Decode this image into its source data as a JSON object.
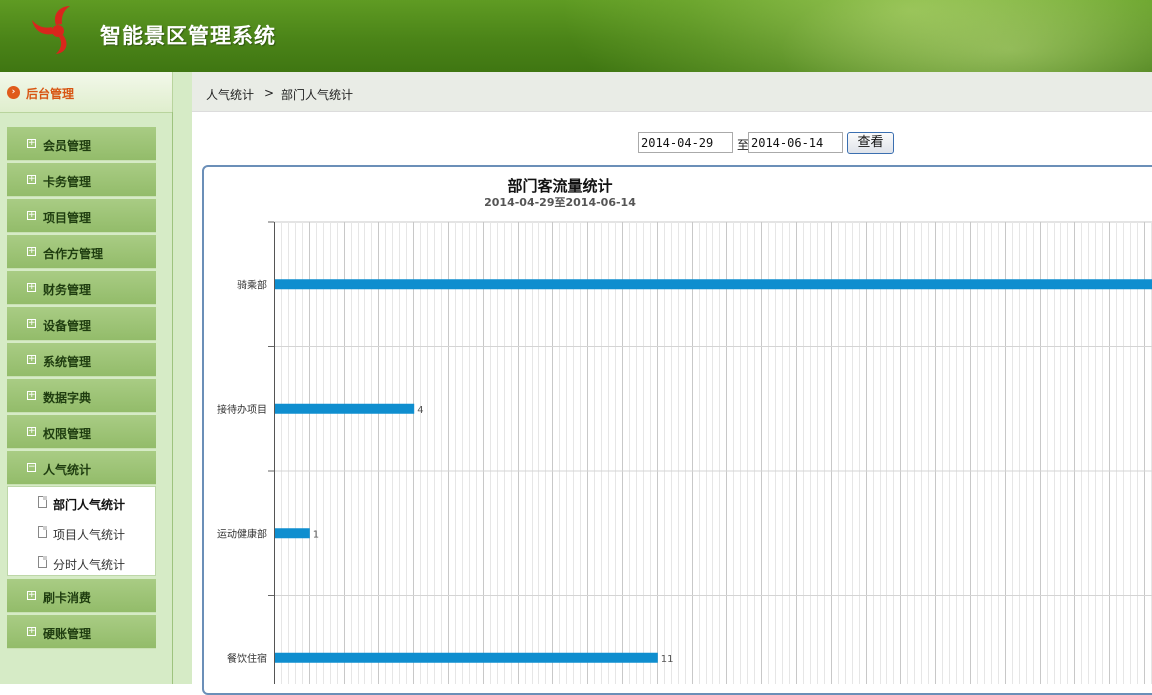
{
  "header": {
    "app_title": "智能景区管理系统"
  },
  "sidebar": {
    "title": "后台管理",
    "menus": [
      {
        "label": "会员管理"
      },
      {
        "label": "卡务管理"
      },
      {
        "label": "项目管理"
      },
      {
        "label": "合作方管理"
      },
      {
        "label": "财务管理"
      },
      {
        "label": "设备管理"
      },
      {
        "label": "系统管理"
      },
      {
        "label": "数据字典"
      },
      {
        "label": "权限管理"
      },
      {
        "label": "人气统计"
      }
    ],
    "submenu": [
      {
        "label": "部门人气统计"
      },
      {
        "label": "项目人气统计"
      },
      {
        "label": "分时人气统计"
      }
    ],
    "menus_after": [
      {
        "label": "刷卡消费"
      },
      {
        "label": "硬账管理"
      }
    ]
  },
  "breadcrumb": {
    "parent": "人气统计",
    "separator": ">",
    "current": "部门人气统计"
  },
  "filter": {
    "start_date": "2014-04-29",
    "to_label": "至",
    "end_date": "2014-06-14",
    "query_label": "查看"
  },
  "colors": {
    "bar": "#0f8ecf",
    "header_green": "#4b8418",
    "sidebar_bg": "#d6ebc6"
  },
  "chart_data": {
    "type": "bar",
    "orientation": "horizontal",
    "title": "部门客流量统计",
    "subtitle": "2014-04-29至2014-06-14",
    "categories": [
      "骑乘部",
      "接待办项目",
      "运动健康部",
      "餐饮住宿"
    ],
    "values": [
      null,
      4,
      1,
      11
    ],
    "value_labels": [
      "",
      "4",
      "1",
      "11"
    ],
    "grid": true,
    "note": "骑乘部 bar extends beyond visible area"
  }
}
